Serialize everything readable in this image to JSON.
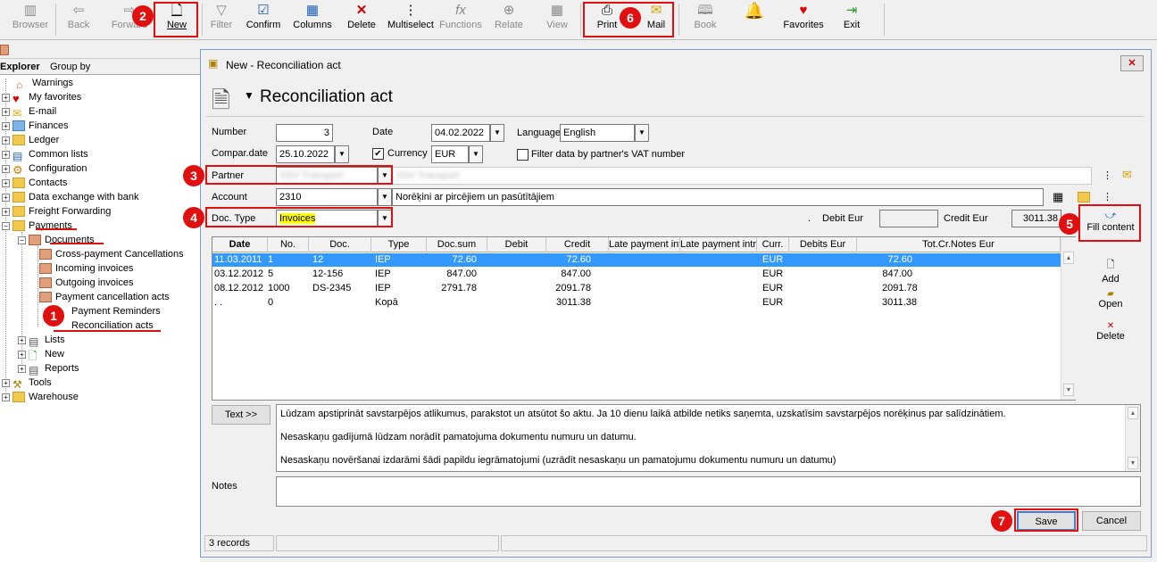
{
  "toolbar": {
    "buttons": [
      "Browser",
      "Back",
      "Forward",
      "New",
      "Filter",
      "Confirm",
      "Columns",
      "Delete",
      "Multiselect",
      "Functions",
      "Relate",
      "View",
      "Print",
      "Mail",
      "Book",
      "Favorites",
      "Exit"
    ],
    "icons": [
      "browser-icon",
      "back-arrow-icon",
      "forward-arrow-icon",
      "new-document-icon",
      "filter-icon",
      "confirm-check-icon",
      "columns-icon",
      "delete-x-icon",
      "multiselect-icon",
      "functions-icon",
      "relate-icon",
      "view-grid-icon",
      "printer-icon",
      "mail-envelope-icon",
      "book-icon",
      "bell-icon",
      "heart-icon",
      "exit-door-icon"
    ]
  },
  "badges": [
    "1",
    "2",
    "3",
    "4",
    "5",
    "6",
    "7"
  ],
  "explorer": {
    "tab_explorer": "Explorer",
    "tab_groupby": "Group by",
    "items": [
      "Warnings",
      "My favorites",
      "E-mail",
      "Finances",
      "Ledger",
      "Common lists",
      "Configuration",
      "Contacts",
      "Data exchange with bank",
      "Freight Forwarding",
      "Payments",
      "Documents",
      "Cross-payment Cancellations",
      "Incoming invoices",
      "Outgoing invoices",
      "Payment cancellation acts",
      "Payment Reminders",
      "Reconciliation acts",
      "Lists",
      "New",
      "Reports",
      "Tools",
      "Warehouse"
    ]
  },
  "dialog": {
    "window_title": "New - Reconciliation act",
    "heading": "Reconciliation act",
    "number_label": "Number",
    "number_value": "3",
    "date_label": "Date",
    "date_value": "04.02.2022",
    "language_label": "Language",
    "language_value": "English",
    "compar_date_label": "Compar.date",
    "compar_date_value": "25.10.2022",
    "currency_label": "Currency",
    "currency_value": "EUR",
    "filter_vat_label": "Filter data by partner's VAT number",
    "partner_label": "Partner",
    "partner_code": "SSV Transport",
    "partner_name": "SSV Transport",
    "account_label": "Account",
    "account_value": "2310",
    "account_name": "Norēķini ar pircējiem un pasūtītājiem",
    "doctype_label": "Doc. Type",
    "doctype_value": "Invoices",
    "dot": ".",
    "debit_label": "Debit Eur",
    "debit_value": "",
    "credit_label": "Credit Eur",
    "credit_value": "3011.38",
    "fill_content": "Fill content",
    "grid": {
      "columns": [
        "Date",
        "No.",
        "Doc.",
        "Type",
        "Doc.sum",
        "Debit",
        "Credit",
        "Late payment intr.",
        "Late payment intr.c.",
        "Curr.",
        "Debits Eur",
        "Tot.Cr.Notes Eur"
      ],
      "rows": [
        [
          "11.03.2011",
          "1",
          "12",
          "IEP",
          "72.60",
          "",
          "72.60",
          "",
          "",
          "EUR",
          "",
          "72.60"
        ],
        [
          "03.12.2012",
          "5",
          "12-156",
          "IEP",
          "847.00",
          "",
          "847.00",
          "",
          "",
          "EUR",
          "",
          "847.00"
        ],
        [
          "08.12.2012",
          "1000",
          "DS-2345",
          "IEP",
          "2791.78",
          "",
          "2091.78",
          "",
          "",
          "EUR",
          "",
          "2091.78"
        ],
        [
          ". .",
          "0",
          "",
          "Kopā",
          "",
          "",
          "3011.38",
          "",
          "",
          "EUR",
          "",
          "3011.38"
        ]
      ]
    },
    "side_add": "Add",
    "side_open": "Open",
    "side_delete": "Delete",
    "text_button": "Text >>",
    "text_lines": [
      "Lūdzam apstiprināt savstarpējos atlikumus, parakstot un atsūtot šo aktu. Ja 10 dienu laikā atbilde netiks saņemta, uzskatīsim savstarpējos norēķinus par salīdzinātiem.",
      "Nesaskaņu gadījumā lūdzam norādīt pamatojuma dokumentu numuru un datumu.",
      "Nesaskaņu novēršanai izdarāmi šādi papildu iegrāmatojumi (uzrādīt nesaskaņu un pamatojumu dokumentu numuru un datumu)"
    ],
    "notes_label": "Notes",
    "save": "Save",
    "cancel": "Cancel",
    "status_records": "3 records"
  },
  "colors": {
    "annotation_red": "#e01010",
    "selection_blue": "#3399ff",
    "highlight_yellow": "#ffff00"
  }
}
